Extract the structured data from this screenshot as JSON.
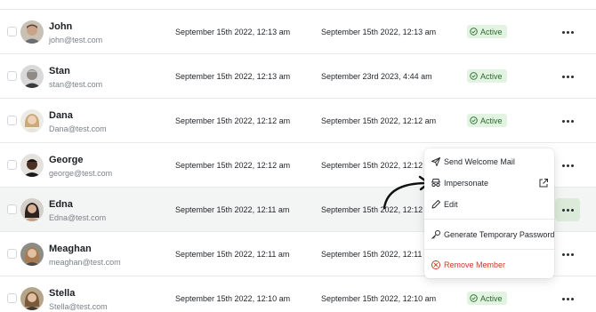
{
  "users": [
    {
      "name": "John",
      "email": "john@test.com",
      "created": "September 15th 2022, 12:13 am",
      "last_login": "September 15th 2022, 12:13 am",
      "status": "Active"
    },
    {
      "name": "Stan",
      "email": "stan@test.com",
      "created": "September 15th 2022, 12:13 am",
      "last_login": "September 23rd 2023, 4:44 am",
      "status": "Active"
    },
    {
      "name": "Dana",
      "email": "Dana@test.com",
      "created": "September 15th 2022, 12:12 am",
      "last_login": "September 15th 2022, 12:12 am",
      "status": "Active"
    },
    {
      "name": "George",
      "email": "george@test.com",
      "created": "September 15th 2022, 12:12 am",
      "last_login": "September 15th 2022, 12:12 am",
      "status": ""
    },
    {
      "name": "Edna",
      "email": "Edna@test.com",
      "created": "September 15th 2022, 12:11 am",
      "last_login": "September 15th 2022, 12:12 am",
      "status": ""
    },
    {
      "name": "Meaghan",
      "email": "meaghan@test.com",
      "created": "September 15th 2022, 12:11 am",
      "last_login": "September 15th 2022, 12:11 am",
      "status": ""
    },
    {
      "name": "Stella",
      "email": "Stella@test.com",
      "created": "September 15th 2022, 12:10 am",
      "last_login": "September 15th 2022, 12:10 am",
      "status": "Active"
    }
  ],
  "menu": {
    "send_welcome_mail": "Send Welcome Mail",
    "impersonate": "Impersonate",
    "edit": "Edit",
    "generate_temp_password": "Generate Temporary Password",
    "remove_member": "Remove Member"
  },
  "icons": {
    "status": "check-circle-icon",
    "more": "more-horizontal-icon",
    "send": "paper-plane-icon",
    "impersonate": "incognito-icon",
    "edit": "pencil-icon",
    "password": "key-icon",
    "remove": "x-circle-icon",
    "external": "external-link-icon"
  },
  "colors": {
    "active_badge_bg": "#e3f3e2",
    "active_badge_text": "#2a6a2d",
    "danger": "#d0352b",
    "highlight_row": "#f3f5f4",
    "more_active_bg": "#dcebd9"
  }
}
